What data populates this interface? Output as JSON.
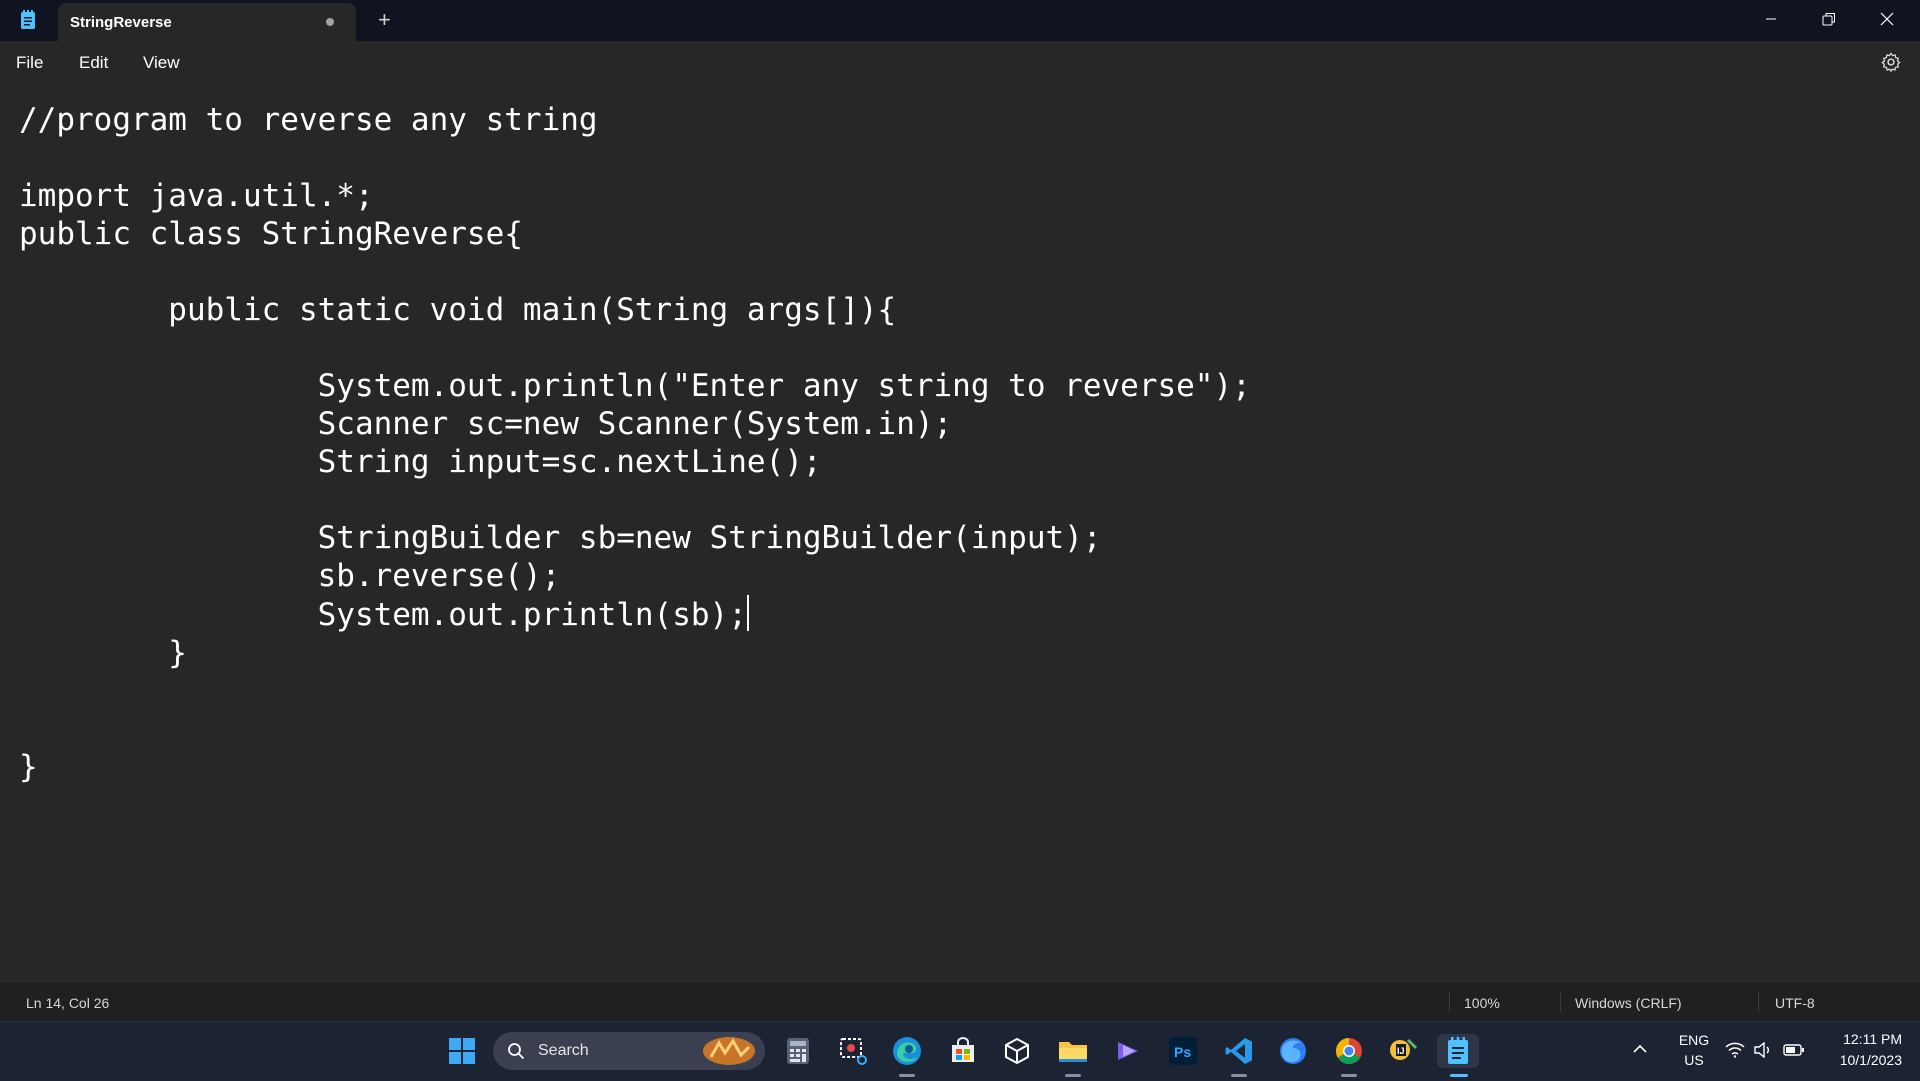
{
  "window": {
    "tab_title": "StringReverse",
    "new_tab_label": "+",
    "controls": [
      "minimize-icon",
      "restore-icon",
      "close-icon"
    ]
  },
  "menu": {
    "file": "File",
    "edit": "Edit",
    "view": "View"
  },
  "editor": {
    "lines": [
      "//program to reverse any string",
      "",
      "import java.util.*;",
      "public class StringReverse{",
      "",
      "\tpublic static void main(String args[]){",
      "",
      "\t\tSystem.out.println(\"Enter any string to reverse\");",
      "\t\tScanner sc=new Scanner(System.in);",
      "\t\tString input=sc.nextLine();",
      "",
      "\t\tStringBuilder sb=new StringBuilder(input);",
      "\t\tsb.reverse();",
      "\t\tSystem.out.println(sb);",
      "\t}",
      "",
      "",
      "}"
    ],
    "caret_line": 14
  },
  "status": {
    "position": "Ln 14, Col 26",
    "zoom": "100%",
    "line_ending": "Windows (CRLF)",
    "encoding": "UTF-8"
  },
  "taskbar": {
    "search_label": "Search",
    "language_top": "ENG",
    "language_bottom": "US",
    "time": "12:11 PM",
    "date": "10/1/2023",
    "pinned": [
      "start-icon",
      "calculator-icon",
      "snipping-tool-icon",
      "edge-icon",
      "store-icon",
      "virtualbox-icon",
      "file-explorer-icon",
      "clipchamp-icon",
      "photoshop-icon",
      "vscode-icon",
      "firefox-icon",
      "chrome-icon",
      "intellij-icon",
      "notepad-icon"
    ]
  },
  "colors": {
    "editor_bg": "#272727",
    "titlebar_bg": "#0f1420",
    "taskbar_bg": "#1c2333",
    "accent": "#4cc2ff"
  }
}
